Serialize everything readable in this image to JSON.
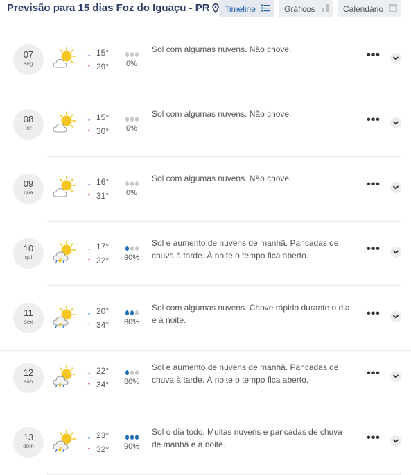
{
  "header": {
    "title": "Previsão para 15 dias Foz do Iguaçu - PR",
    "location_icon": "map-pin-icon",
    "tabs": [
      {
        "label": "Timeline",
        "icon": "list-icon",
        "active": true
      },
      {
        "label": "Gráficos",
        "icon": "bar-chart-icon",
        "active": false
      },
      {
        "label": "Calendário",
        "icon": "calendar-icon",
        "active": false
      }
    ]
  },
  "colors": {
    "title": "#2b3a67",
    "active_tab": "#2a62b7",
    "min_arrow": "#2a7bd0",
    "max_arrow": "#d43a3a",
    "rain_drop": "#1f6fb8"
  },
  "days": [
    {
      "day": "07",
      "weekday": "seg",
      "icon": "sun-cloud-icon",
      "min": "15°",
      "max": "29°",
      "rain_drops": 0,
      "rain": "0%",
      "description": "Sol com algumas nuvens. Não chove."
    },
    {
      "day": "08",
      "weekday": "ter",
      "icon": "sun-cloud-icon",
      "min": "15°",
      "max": "30°",
      "rain_drops": 0,
      "rain": "0%",
      "description": "Sol com algumas nuvens. Não chove."
    },
    {
      "day": "09",
      "weekday": "qua",
      "icon": "sun-cloud-icon",
      "min": "16°",
      "max": "31°",
      "rain_drops": 0,
      "rain": "0%",
      "description": "Sol com algumas nuvens. Não chove."
    },
    {
      "day": "10",
      "weekday": "qui",
      "icon": "sun-storm-icon",
      "min": "17°",
      "max": "32°",
      "rain_drops": 1,
      "rain": "90%",
      "description": "Sol e aumento de nuvens de manhã. Pancadas de chuva à tarde. À noite o tempo fica aberto."
    },
    {
      "day": "11",
      "weekday": "sex",
      "icon": "sun-storm-icon",
      "min": "20°",
      "max": "34°",
      "rain_drops": 2,
      "rain": "80%",
      "description": "Sol com algumas nuvens. Chove rápido durante o dia e à noite."
    },
    {
      "day": "12",
      "weekday": "sáb",
      "icon": "sun-storm-icon",
      "min": "22°",
      "max": "34°",
      "rain_drops": 1,
      "rain": "80%",
      "description": "Sol e aumento de nuvens de manhã. Pancadas de chuva à tarde. À noite o tempo fica aberto."
    },
    {
      "day": "13",
      "weekday": "dom",
      "icon": "sun-storm-icon",
      "min": "23°",
      "max": "32°",
      "rain_drops": 3,
      "rain": "90%",
      "description": "Sol o dia todo. Muitas nuvens e pancadas de chuva de manhã e à noite."
    }
  ],
  "more_icon": "more-dots-icon",
  "expand_icon": "chevron-down-icon"
}
